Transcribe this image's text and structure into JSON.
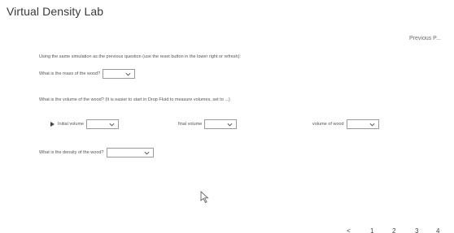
{
  "header": {
    "title": "Virtual Density Lab",
    "previous_link": "Previous P..."
  },
  "instructions": "Using the same simulation as the previous question (use the reset button in the lower right or refresh):",
  "questions": {
    "mass": {
      "label": "What is the mass of the wood?",
      "selected": ""
    },
    "volume_prompt": "What is the volume of the wood? (It is easier to start in Drop Fluid to measure volumes, set to ...)",
    "initial_volume": {
      "label": "Initial volume",
      "selected": ""
    },
    "final_volume": {
      "label": "final volume",
      "selected": ""
    },
    "volume_wood": {
      "label": "volume of wood",
      "selected": ""
    },
    "density": {
      "label": "What is the density of the wood?",
      "selected": ""
    }
  },
  "pagination": {
    "prev": "<",
    "pages": [
      "1",
      "2",
      "3",
      "4"
    ]
  },
  "icons": {
    "dropdown": "chevron-down-icon",
    "bullet": "triangle-bullet-icon",
    "cursor": "mouse-pointer-icon"
  },
  "colors": {
    "border": "#9a9a9a",
    "text": "#555555"
  }
}
